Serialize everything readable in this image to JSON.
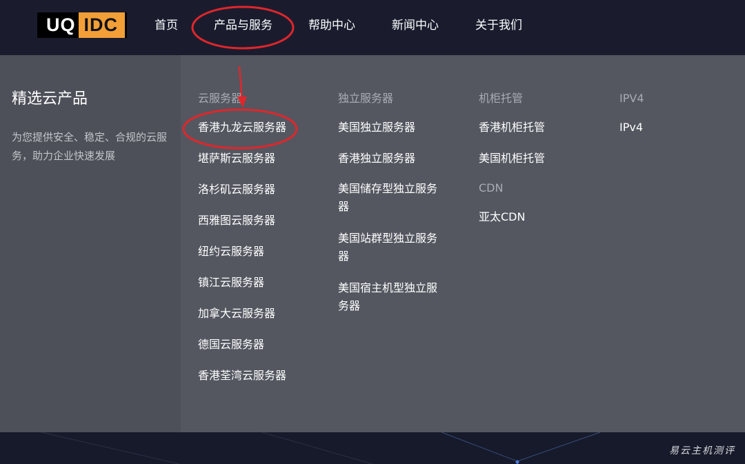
{
  "logo": {
    "part1": "UQ",
    "part2": "IDC"
  },
  "nav": {
    "items": [
      "首页",
      "产品与服务",
      "帮助中心",
      "新闻中心",
      "关于我们"
    ]
  },
  "mega": {
    "title": "精选云产品",
    "description": "为您提供安全、稳定、合规的云服务，助力企业快速发展",
    "cloud": {
      "heading": "云服务器",
      "items": [
        "香港九龙云服务器",
        "堪萨斯云服务器",
        "洛杉矶云服务器",
        "西雅图云服务器",
        "纽约云服务器",
        "镇江云服务器",
        "加拿大云服务器",
        "德国云服务器",
        "香港荃湾云服务器"
      ]
    },
    "dedicated": {
      "heading": "独立服务器",
      "items": [
        "美国独立服务器",
        "香港独立服务器",
        "美国储存型独立服务器",
        "美国站群型独立服务器",
        "美国宿主机型独立服务器"
      ]
    },
    "colo": {
      "heading": "机柜托管",
      "items": [
        "香港机柜托管",
        "美国机柜托管"
      ]
    },
    "cdn": {
      "heading": "CDN",
      "items": [
        "亚太CDN"
      ]
    },
    "ipv4": {
      "heading": "IPV4",
      "items": [
        "IPv4"
      ]
    }
  },
  "watermark": "易云主机测评",
  "colors": {
    "topbar": "#1a1c2e",
    "logo_accent": "#f29f38",
    "mega_bg": "#545760",
    "mega_left_bg": "#4d5058",
    "annotation_red": "#e0262b"
  }
}
